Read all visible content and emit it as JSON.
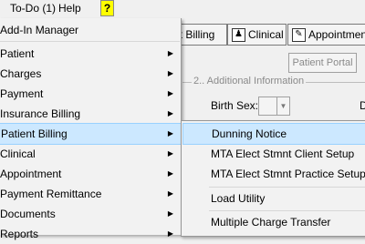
{
  "menubar": {
    "items": [
      "To-Do (1)",
      "Help"
    ],
    "question_icon": "?"
  },
  "toolbar": {
    "tabs": [
      "nt Billing",
      "Clinical",
      "Appointment"
    ]
  },
  "background": {
    "portal_button": "Patient Portal",
    "group_label": "2.. Additional Information",
    "birth_sex_label": "Birth Sex:",
    "d_label": "D"
  },
  "menu": {
    "items": [
      {
        "label": "Add-In Manager",
        "submenu": false
      },
      {
        "label": "Patient",
        "submenu": true
      },
      {
        "label": "Charges",
        "submenu": true
      },
      {
        "label": "Payment",
        "submenu": true
      },
      {
        "label": "Insurance Billing",
        "submenu": true
      },
      {
        "label": "Patient Billing",
        "submenu": true,
        "highlighted": true
      },
      {
        "label": "Clinical",
        "submenu": true
      },
      {
        "label": "Appointment",
        "submenu": true
      },
      {
        "label": "Payment Remittance",
        "submenu": true
      },
      {
        "label": "Documents",
        "submenu": true
      },
      {
        "label": "Reports",
        "submenu": true
      }
    ]
  },
  "submenu": {
    "items": [
      {
        "label": "Dunning Notice",
        "highlighted": true
      },
      {
        "label": "MTA Elect Stmnt Client Setup"
      },
      {
        "label": "MTA Elect Stmnt Practice Setup"
      },
      {
        "label": "Load Utility"
      },
      {
        "label": "Multiple Charge Transfer"
      }
    ]
  }
}
